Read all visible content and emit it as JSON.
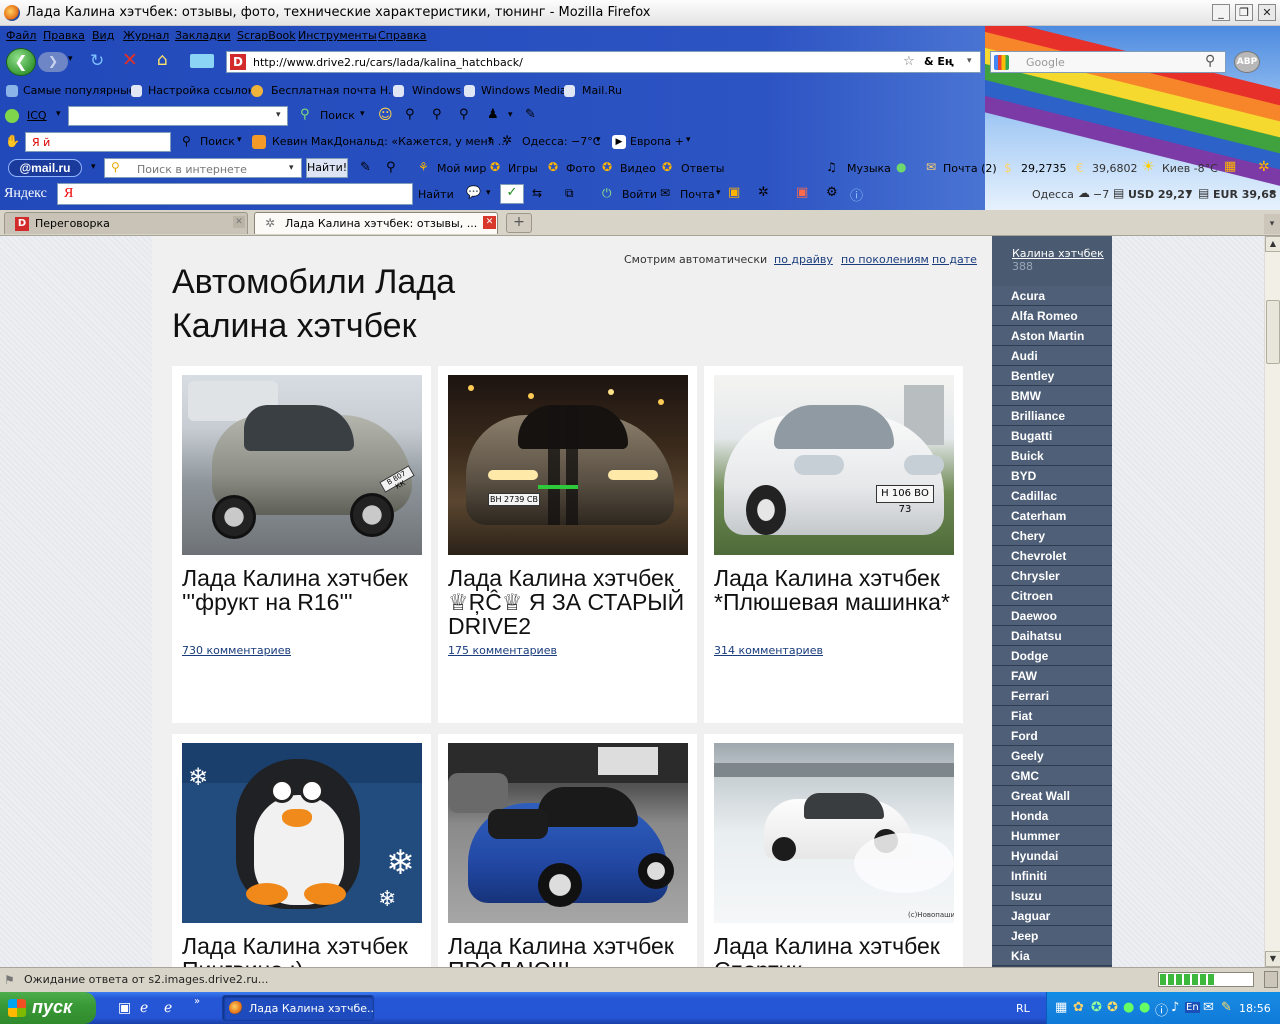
{
  "window": {
    "title": "Лада Калина хэтчбек: отзывы, фото, технические характеристики, тюнинг - Mozilla Firefox",
    "min_btn": "_",
    "max_btn": "❐",
    "close_btn": "✕"
  },
  "menu": [
    "Файл",
    "Правка",
    "Вид",
    "Журнал",
    "Закладки",
    "ScrapBook",
    "Инструменты",
    "Справка"
  ],
  "nav": {
    "url": "http://www.drive2.ru/cars/lada/kalina_hatchback/",
    "url_tail": "& Eң",
    "search_placeholder": "Google",
    "abp": "ABP"
  },
  "bookmarks": [
    "Самые популярные",
    "Настройка ссылок",
    "Бесплатная почта Н...",
    "Windows",
    "Windows Media",
    "Mail.Ru"
  ],
  "icq_bar": {
    "icq": "ICQ",
    "search": "Поиск"
  },
  "ya_bar": {
    "field": "Я  й",
    "search": "Поиск",
    "news": "Кевин МакДональд: «Кажется, у меня ...",
    "weather": "Одесса: −7°C",
    "europe": "Европа +"
  },
  "mailru_bar": {
    "logo": "@mail.ru",
    "placeholder": "Поиск в интернете",
    "find": "Найти!",
    "items": [
      "Мой мир",
      "Игры",
      "Фото",
      "Видео",
      "Ответы",
      "Музыка",
      "Почта (2)",
      "29,2735",
      "39,6802",
      "Киев -8°C"
    ]
  },
  "yandex_bar": {
    "logo": "Яндекс",
    "find": "Найти",
    "enter": "Войти",
    "mail": "Почта",
    "city": "Одесса",
    "temp": "−7",
    "usd": "USD 29,27",
    "eur": "EUR 39,68"
  },
  "tabs": [
    {
      "label": "Переговорка",
      "active": false
    },
    {
      "label": "Лада Калина хэтчбек: отзывы, ...",
      "active": true
    }
  ],
  "new_tab": "+",
  "page": {
    "heading": "Автомобили Лада Калина хэтчбек",
    "sort_label": "Смотрим автоматически",
    "sort_links": [
      "по драйву",
      "по поколениям",
      "по дате"
    ],
    "cards": [
      {
        "title": "Лада Калина хэтчбек '''фрукт на R16'''",
        "comments": "730 комментариев"
      },
      {
        "title": "Лада Калина хэтчбек ♕ŖĈ♕ Я ЗА СТАРЫЙ DRIVE2",
        "comments": "175 комментариев"
      },
      {
        "title": "Лада Калина хэтчбек *Плюшевая машинка*",
        "comments": "314 комментариев"
      },
      {
        "title": "Лада Калина хэтчбек Пингвино :)",
        "comments": ""
      },
      {
        "title": "Лада Калина хэтчбек ПРОДАЮ!!!",
        "comments": ""
      },
      {
        "title": "Лада Калина хэтчбек Спортик",
        "comments": ""
      }
    ],
    "plates": [
      "В 807 КК",
      "ВН 2739 СВ",
      "Н 106 ВО 73"
    ],
    "photo_credit": "(c)Новопашин"
  },
  "sidebar": {
    "current": "Калина хэтчбек",
    "count": "388",
    "brands": [
      "Acura",
      "Alfa Romeo",
      "Aston Martin",
      "Audi",
      "Bentley",
      "BMW",
      "Brilliance",
      "Bugatti",
      "Buick",
      "BYD",
      "Cadillac",
      "Caterham",
      "Chery",
      "Chevrolet",
      "Chrysler",
      "Citroen",
      "Daewoo",
      "Daihatsu",
      "Dodge",
      "FAW",
      "Ferrari",
      "Fiat",
      "Ford",
      "Geely",
      "GMC",
      "Great Wall",
      "Honda",
      "Hummer",
      "Hyundai",
      "Infiniti",
      "Isuzu",
      "Jaguar",
      "Jeep",
      "Kia"
    ]
  },
  "status": {
    "text": "Ожидание ответа от s2.images.drive2.ru...",
    "progress": 0.6
  },
  "taskbar": {
    "start": "пуск",
    "task": "Лада Калина хэтчбе...",
    "lang": "RL",
    "lang2": "En",
    "clock": "18:56"
  },
  "colors": {
    "chrome_blue": "#2149b9",
    "sidebar": "#3c4d66",
    "link": "#1a3c7c"
  }
}
